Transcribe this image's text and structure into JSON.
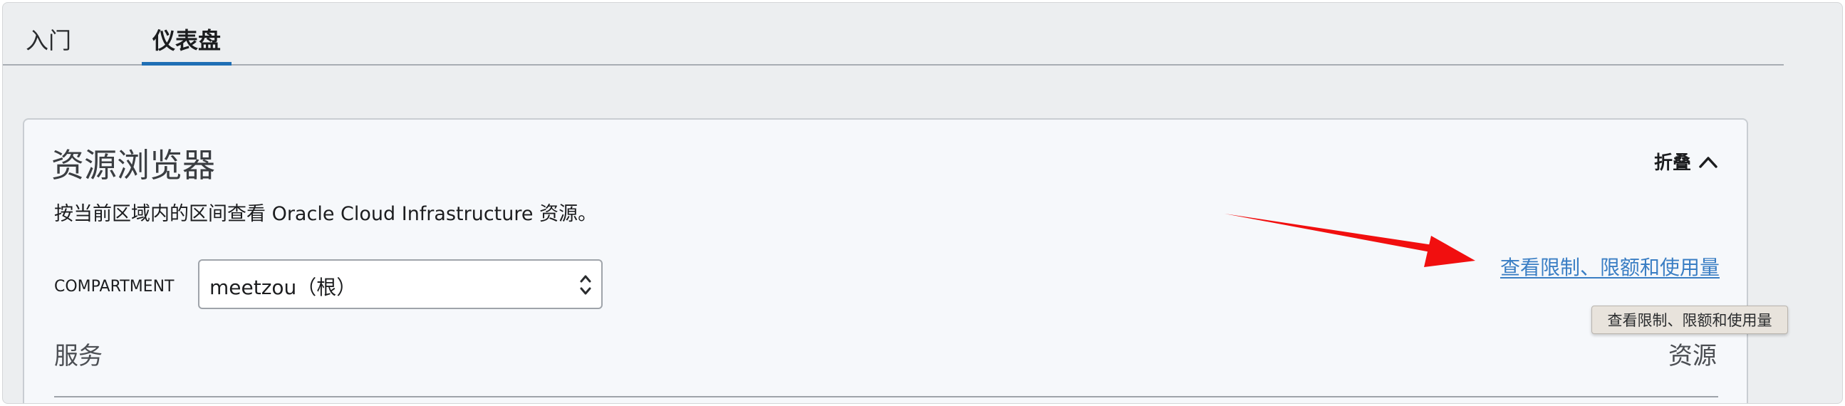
{
  "tabs": [
    {
      "label": "入门",
      "active": false
    },
    {
      "label": "仪表盘",
      "active": true
    }
  ],
  "panel": {
    "title": "资源浏览器",
    "collapse_label": "折叠",
    "description": "按当前区域内的区间查看 Oracle Cloud Infrastructure 资源。",
    "compartment_label": "COMPARTMENT",
    "compartment_value": "meetzou（根）",
    "limits_link": "查看限制、限额和使用量",
    "tooltip": "查看限制、限额和使用量",
    "services_header": "服务",
    "resources_header": "资源"
  },
  "colors": {
    "accent": "#1f6fb5",
    "link": "#3a7ec4",
    "annotation": "#f10f0f"
  },
  "icons": {
    "collapse": "chevron-up-icon",
    "select": "select-chevrons-icon",
    "annotation": "red-arrow-annotation"
  }
}
